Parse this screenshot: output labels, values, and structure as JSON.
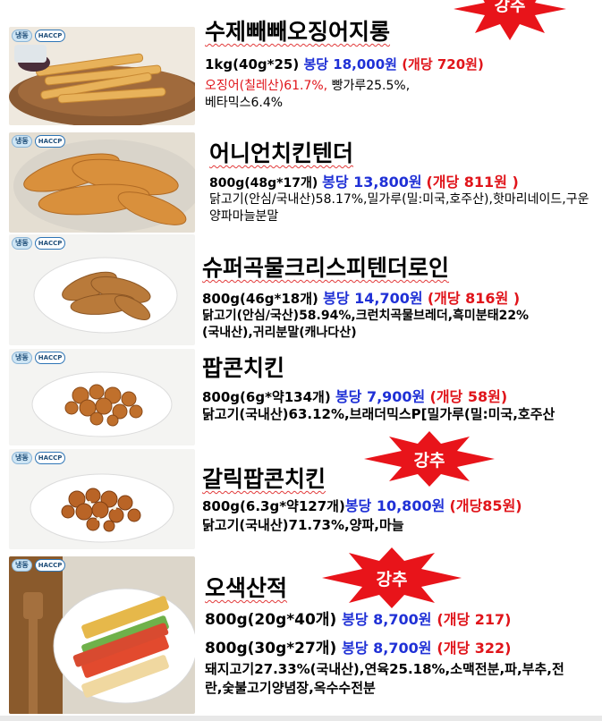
{
  "badges": {
    "frozen": "냉동",
    "haccp": "HACCP"
  },
  "star_label": "강추",
  "colors": {
    "blue": "#1f30d6",
    "red": "#e0141a",
    "star": "#e8141a"
  },
  "products": [
    {
      "title": "수제빼빼오징어지롱",
      "spec": "1kg(40g*25)",
      "bag_price": "봉당 18,000원",
      "unit_price": "(개당 720원)",
      "ingredient_red": "오징어(칠레산)61.7%,",
      "ingredient_rest": " 빵가루25.5%,",
      "ingredient_line2": "베타믹스6.4%",
      "recommended": true
    },
    {
      "title": "어니언치킨텐더",
      "spec": "800g(48g*17개)",
      "bag_price": "봉당  13,800원",
      "unit_price": "(개당 811원 )",
      "ingredients": "닭고기(안심/국내산)58.17%,밀가루(밀:미국,호주산),핫마리네이드,구운양파마늘분말",
      "recommended": false
    },
    {
      "title": "슈퍼곡물크리스피텐더로인",
      "spec": "800g(46g*18개)",
      "bag_price": "봉당 14,700원",
      "unit_price": "(개당 816원 )",
      "ingredients": "닭고기(안심/국산)58.94%,크런치곡물브레더,흑미분태22%(국내산),귀리분말(캐나다산)",
      "recommended": false
    },
    {
      "title": "팝콘치킨",
      "spec": "800g(6g*약134개)",
      "bag_price": "봉당 7,900원",
      "unit_price": "(개당 58원)",
      "ingredients": "닭고기(국내산)63.12%,브래더믹스P[밀가루(밀:미국,호주산",
      "recommended": false
    },
    {
      "title": "갈릭팝콘치킨",
      "spec": "800g(6.3g*약127개)",
      "bag_price": "봉당 10,800원",
      "unit_price": "(개당85원)",
      "ingredients": "닭고기(국내산)71.73%,양파,마늘",
      "recommended": true
    },
    {
      "title": "오색산적",
      "spec": "800g(20g*40개)",
      "bag_price": "봉당 8,700원",
      "unit_price": "(개당  217)",
      "spec2": "800g(30g*27개)",
      "bag_price2": "봉당 8,700원",
      "unit_price2": "(개당  322)",
      "ingredients": "돼지고기27.33%(국내산),연육25.18%,소맥전분,파,부추,전란,숯불고기양념장,옥수수전분",
      "recommended": true
    }
  ]
}
